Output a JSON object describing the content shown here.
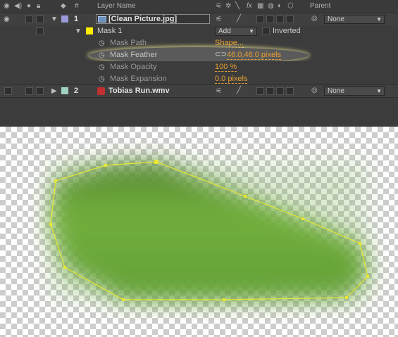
{
  "header": {
    "hash": "#",
    "layer_name": "Layer Name",
    "parent": "Parent",
    "fx": "fx"
  },
  "layers": [
    {
      "index": "1",
      "name": "[Clean Picture.jpg]",
      "label_color": "#9a9ad8",
      "parent": "None"
    },
    {
      "index": "2",
      "name": "Tobias Run.wmv",
      "label_color": "#9fd0c0",
      "parent": "None"
    }
  ],
  "mask": {
    "name": "Mask 1",
    "color": "#ffee00",
    "mode": "Add",
    "inverted_label": "Inverted",
    "properties": [
      {
        "label": "Mask Path",
        "value": "Shape..."
      },
      {
        "label": "Mask Feather",
        "value": "46.0,46.0 pixels"
      },
      {
        "label": "Mask Opacity",
        "value": "100 %"
      },
      {
        "label": "Mask Expansion",
        "value": "0.0 pixels"
      }
    ]
  },
  "colors": {
    "accent": "#e8a033",
    "mask_outline": "#e8e830",
    "grass": "#5fa030"
  }
}
